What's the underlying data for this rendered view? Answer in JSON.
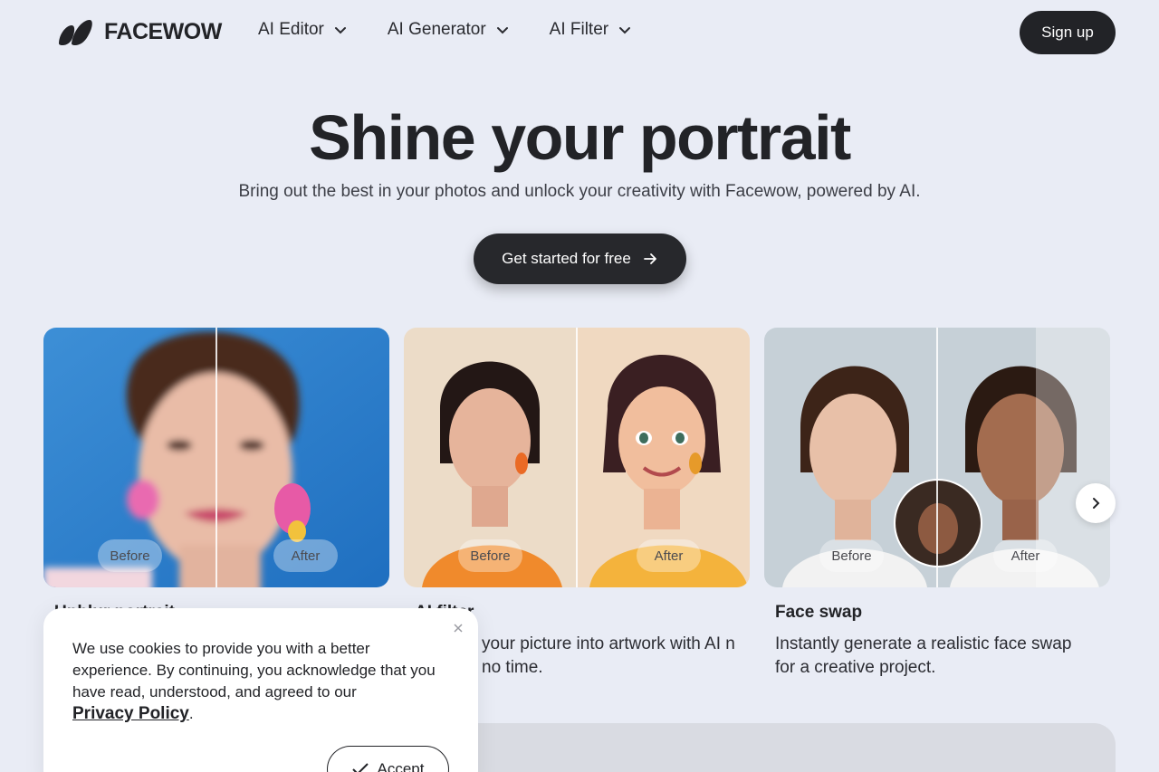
{
  "header": {
    "logo_text": "FACEWOW",
    "nav": [
      {
        "label": "AI Editor"
      },
      {
        "label": "AI Generator"
      },
      {
        "label": "AI Filter"
      }
    ],
    "signup_label": "Sign up"
  },
  "hero": {
    "title": "Shine your portrait",
    "subtitle": "Bring out the best in your photos and unlock your creativity with Facewow, powered by AI.",
    "cta_label": "Get started for free"
  },
  "cards": [
    {
      "title": "Unblur portrait",
      "description": "",
      "before_label": "Before",
      "after_label": "After"
    },
    {
      "title": "AI filter",
      "description": "your picture into artwork with AI n no time.",
      "before_label": "Before",
      "after_label": "After"
    },
    {
      "title": "Face swap",
      "description": "Instantly generate a realistic face swap for a creative project.",
      "before_label": "Before",
      "after_label": "After"
    }
  ],
  "cookie": {
    "text": "We use cookies to provide you with a better experience. By continuing, you acknowledge that you have read, understood, and agreed to our",
    "link_label": "Privacy Policy",
    "accept_label": "Accept"
  },
  "colors": {
    "background": "#e9ecf5",
    "dark": "#222327",
    "white": "#ffffff"
  }
}
